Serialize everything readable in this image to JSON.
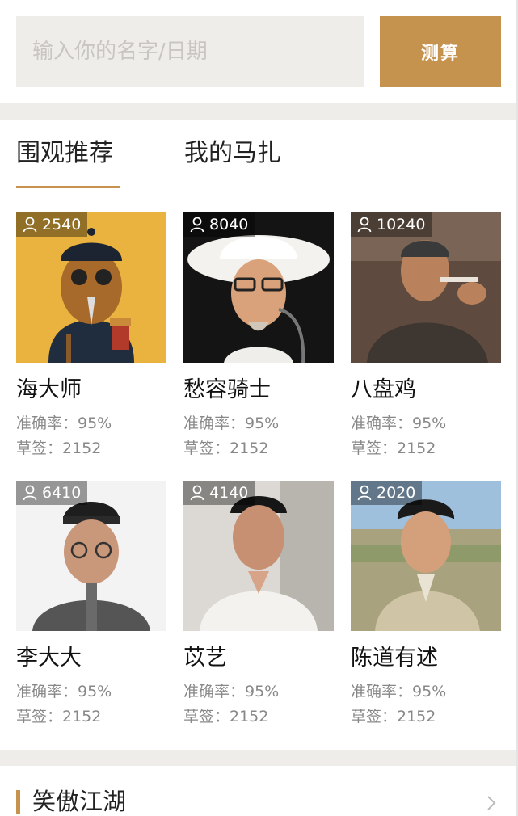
{
  "search": {
    "placeholder": "输入你的名字/日期",
    "button_label": "测算"
  },
  "tabs": [
    {
      "label": "围观推荐"
    },
    {
      "label": "我的马扎"
    }
  ],
  "cards": [
    {
      "views": "2540",
      "name": "海大师",
      "accuracy": "准确率：95%",
      "draws": "草签：2152"
    },
    {
      "views": "8040",
      "name": "愁容骑士",
      "accuracy": "准确率：95%",
      "draws": "草签：2152"
    },
    {
      "views": "10240",
      "name": "八盘鸡",
      "accuracy": "准确率：95%",
      "draws": "草签：2152"
    },
    {
      "views": "6410",
      "name": "李大大",
      "accuracy": "准确率：95%",
      "draws": "草签：2152"
    },
    {
      "views": "4140",
      "name": "苡艺",
      "accuracy": "准确率：95%",
      "draws": "草签：2152"
    },
    {
      "views": "2020",
      "name": "陈道有述",
      "accuracy": "准确率：95%",
      "draws": "草签：2152"
    }
  ],
  "section": {
    "title": "笑傲江湖"
  },
  "icons": {
    "views": "user-icon",
    "more": "chevron-right-icon"
  },
  "colors": {
    "accent": "#c6934f",
    "page_gap": "#efedea",
    "muted_text": "#888888"
  }
}
